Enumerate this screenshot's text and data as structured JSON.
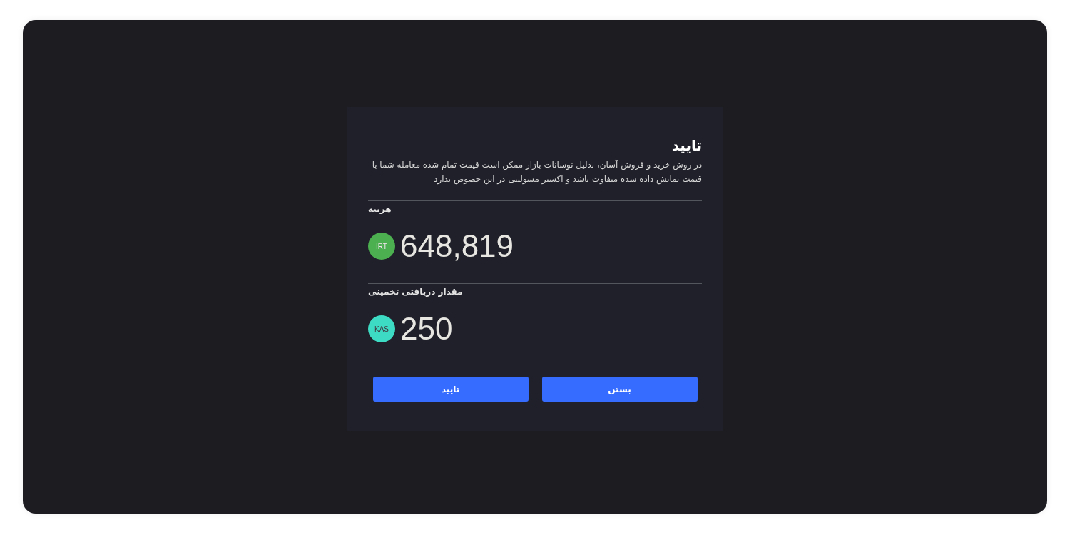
{
  "dialog": {
    "title": "تایید",
    "message": "در روش خرید و فروش آسان، بدلیل نوسانات بازار ممکن است قیمت تمام شده معامله شما با قیمت نمایش داده شده متفاوت باشد و اکسیر مسولیتی در این خصوص ندارد",
    "sections": [
      {
        "label": "هزینه",
        "amount": "648,819",
        "currency": {
          "code": "IRT",
          "color": "#4caf50"
        }
      },
      {
        "label": "مقدار دریافتی تخمینی",
        "amount": "250",
        "currency": {
          "code": "KAS",
          "color": "#3ddbc3"
        }
      }
    ],
    "buttons": [
      {
        "label": "بستن"
      },
      {
        "label": "تایید"
      }
    ]
  }
}
